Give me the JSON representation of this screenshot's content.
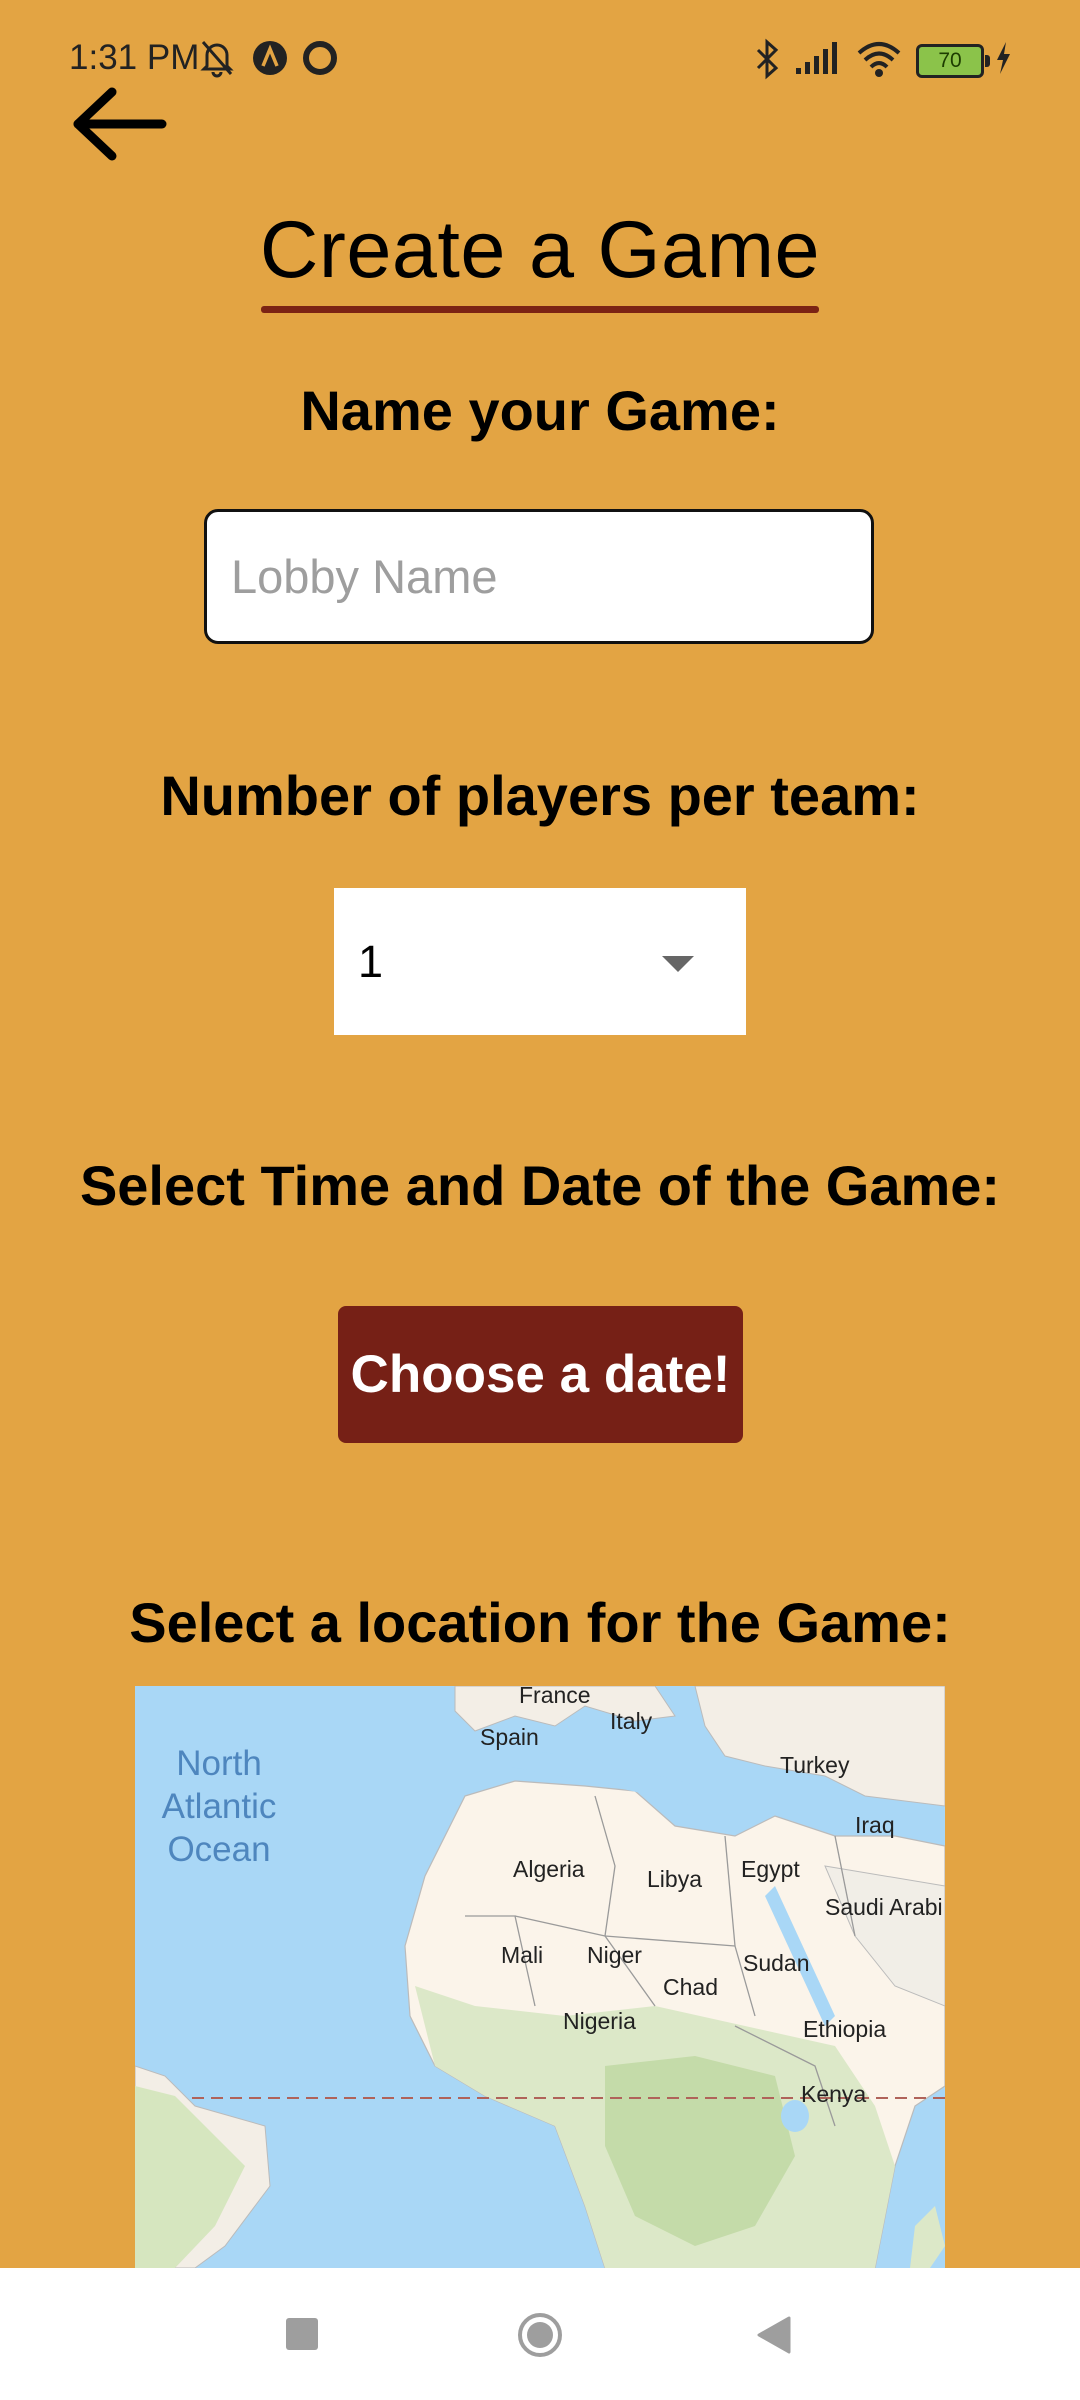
{
  "status_bar": {
    "time": "1:31 PM",
    "battery_level": "70",
    "icons": [
      "bell-off-icon",
      "a-circle-icon",
      "circle-icon",
      "bluetooth-icon",
      "signal-icon",
      "wifi-icon",
      "battery-icon",
      "charging-icon"
    ]
  },
  "header": {
    "back_icon": "arrow-left-icon",
    "title": "Create a Game"
  },
  "form": {
    "name_label": "Name your Game:",
    "lobby_placeholder": "Lobby Name",
    "lobby_value": "",
    "players_label": "Number of players per team:",
    "players_value": "1",
    "date_label": "Select Time and Date of the Game:",
    "date_button": "Choose a date!",
    "location_label": "Select a location for the Game:"
  },
  "map": {
    "ocean_label": "North\nAtlantic\nOcean",
    "place_labels": [
      "France",
      "Spain",
      "Italy",
      "Turkey",
      "Iraq",
      "Algeria",
      "Libya",
      "Egypt",
      "Saudi Arabi",
      "Mali",
      "Niger",
      "Chad",
      "Sudan",
      "Nigeria",
      "Ethiopia",
      "Kenya"
    ]
  },
  "nav_bar": {
    "icons": [
      "recents-square-icon",
      "home-circle-icon",
      "back-triangle-icon"
    ]
  },
  "colors": {
    "background": "#E3A443",
    "accent": "#762016",
    "underline": "#7B2314",
    "ocean": "#A9D7F6"
  }
}
